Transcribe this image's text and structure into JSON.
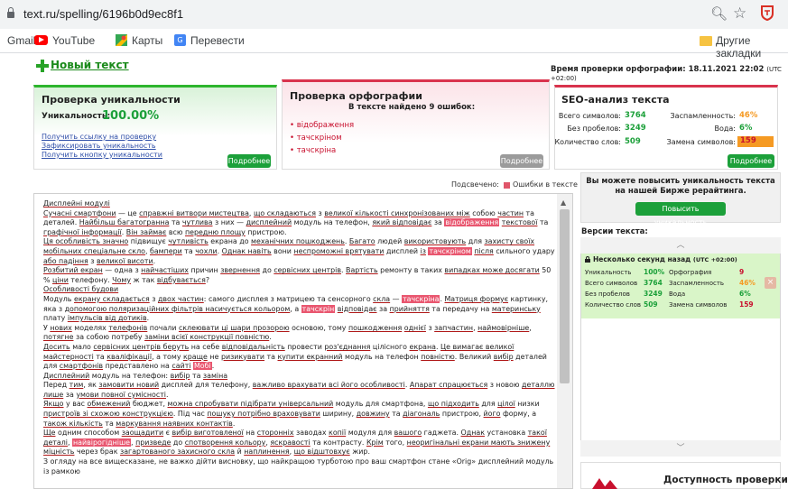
{
  "browser": {
    "url": "text.ru/spelling/6196b0d9ec8f1",
    "bookmarks": {
      "gmail": "Gmail",
      "youtube": "YouTube",
      "maps": "Карты",
      "translate": "Перевести",
      "other": "Другие закладки"
    }
  },
  "page": {
    "new_text": "Новый текст",
    "check_time_label": "Время проверки орфографии: 18.11.2021 22:02",
    "check_time_tz": "(UTC +02:00)",
    "uniqueness": {
      "title": "Проверка уникальности",
      "label": "Уникальность:",
      "value": "100.00%",
      "links": [
        "Получить ссылку на проверку",
        "Зафиксировать уникальность",
        "Получить кнопку уникальности"
      ],
      "more": "Подробнее"
    },
    "spelling": {
      "title": "Проверка орфографии",
      "found": "В тексте найдено 9 ошибок:",
      "errors": [
        "відображення",
        "тачскріном",
        "тачскріна"
      ],
      "more": "Подробнее"
    },
    "seo": {
      "title": "SEO-анализ текста",
      "rows": [
        {
          "label": "Всего символов:",
          "value": "3764"
        },
        {
          "label": "Без пробелов:",
          "value": "3249"
        },
        {
          "label": "Количество слов:",
          "value": "509"
        }
      ],
      "spam_label": "Заспамленность:",
      "spam_value": "46%",
      "water_label": "Вода:",
      "water_value": "6%",
      "replace_label": "Замена символов:",
      "replace_value": "159",
      "more": "Подробнее"
    },
    "legend": {
      "highlighted": "Подсвечено:",
      "errors": "Ошибки в тексте"
    },
    "promo": {
      "text": "Вы можете повысить уникальность текста на нашей Бирже рерайтинга.",
      "button": "Повысить уникальность"
    },
    "versions": {
      "title": "Версии текста:",
      "item_title": "Несколько секунд назад",
      "item_tz": "(UTC +02:00)",
      "uniq_label": "Уникальность",
      "uniq_value": "100%",
      "spell_label": "Орфография",
      "spell_value": "9",
      "chars_label": "Всего символов",
      "chars_value": "3764",
      "spam_label": "Заспамленность",
      "spam_value": "46%",
      "nospace_label": "Без пробелов",
      "nospace_value": "3249",
      "water_label": "Вода",
      "water_value": "6%",
      "words_label": "Количество слов",
      "words_value": "509",
      "replace_label": "Замена символов",
      "replace_value": "159"
    },
    "access_title": "Доступность проверки"
  },
  "colors": {
    "green": "#1ca03a",
    "red": "#c8102e",
    "highlight": "#e9566f",
    "orange": "#f59a23"
  }
}
